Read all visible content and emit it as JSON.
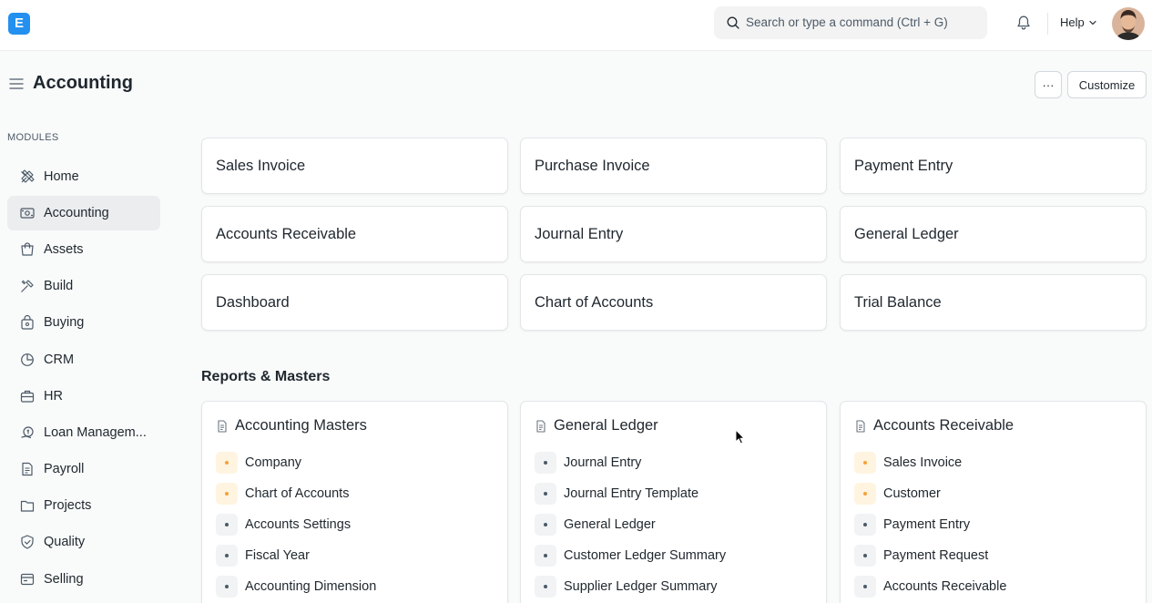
{
  "navbar": {
    "logo_letter": "E",
    "search_placeholder": "Search or type a command (Ctrl + G)",
    "help_label": "Help"
  },
  "page": {
    "title": "Accounting",
    "more_label": "···",
    "customize_label": "Customize"
  },
  "sidebar": {
    "section_label": "MODULES",
    "items": [
      {
        "label": "Home",
        "icon": "home-icon"
      },
      {
        "label": "Accounting",
        "icon": "accounting-icon",
        "active": true
      },
      {
        "label": "Assets",
        "icon": "assets-icon"
      },
      {
        "label": "Build",
        "icon": "build-icon"
      },
      {
        "label": "Buying",
        "icon": "buying-icon"
      },
      {
        "label": "CRM",
        "icon": "crm-icon"
      },
      {
        "label": "HR",
        "icon": "hr-icon"
      },
      {
        "label": "Loan Managem...",
        "icon": "loan-icon"
      },
      {
        "label": "Payroll",
        "icon": "payroll-icon"
      },
      {
        "label": "Projects",
        "icon": "projects-icon"
      },
      {
        "label": "Quality",
        "icon": "quality-icon"
      },
      {
        "label": "Selling",
        "icon": "selling-icon"
      }
    ]
  },
  "shortcuts": [
    "Sales Invoice",
    "Purchase Invoice",
    "Payment Entry",
    "Accounts Receivable",
    "Journal Entry",
    "General Ledger",
    "Dashboard",
    "Chart of Accounts",
    "Trial Balance"
  ],
  "reports": {
    "section_title": "Reports & Masters",
    "cards": [
      {
        "title": "Accounting Masters",
        "links": [
          {
            "label": "Company",
            "highlight": true
          },
          {
            "label": "Chart of Accounts",
            "highlight": true
          },
          {
            "label": "Accounts Settings",
            "highlight": false
          },
          {
            "label": "Fiscal Year",
            "highlight": false
          },
          {
            "label": "Accounting Dimension",
            "highlight": false
          }
        ]
      },
      {
        "title": "General Ledger",
        "links": [
          {
            "label": "Journal Entry",
            "highlight": false
          },
          {
            "label": "Journal Entry Template",
            "highlight": false
          },
          {
            "label": "General Ledger",
            "highlight": false
          },
          {
            "label": "Customer Ledger Summary",
            "highlight": false
          },
          {
            "label": "Supplier Ledger Summary",
            "highlight": false
          }
        ]
      },
      {
        "title": "Accounts Receivable",
        "links": [
          {
            "label": "Sales Invoice",
            "highlight": true
          },
          {
            "label": "Customer",
            "highlight": true
          },
          {
            "label": "Payment Entry",
            "highlight": false
          },
          {
            "label": "Payment Request",
            "highlight": false
          },
          {
            "label": "Accounts Receivable",
            "highlight": false
          }
        ]
      }
    ]
  },
  "colors": {
    "brand": "#2490ef",
    "text": "#1f272e",
    "muted": "#4c5a67",
    "highlight_dot": "#f3a23a"
  }
}
